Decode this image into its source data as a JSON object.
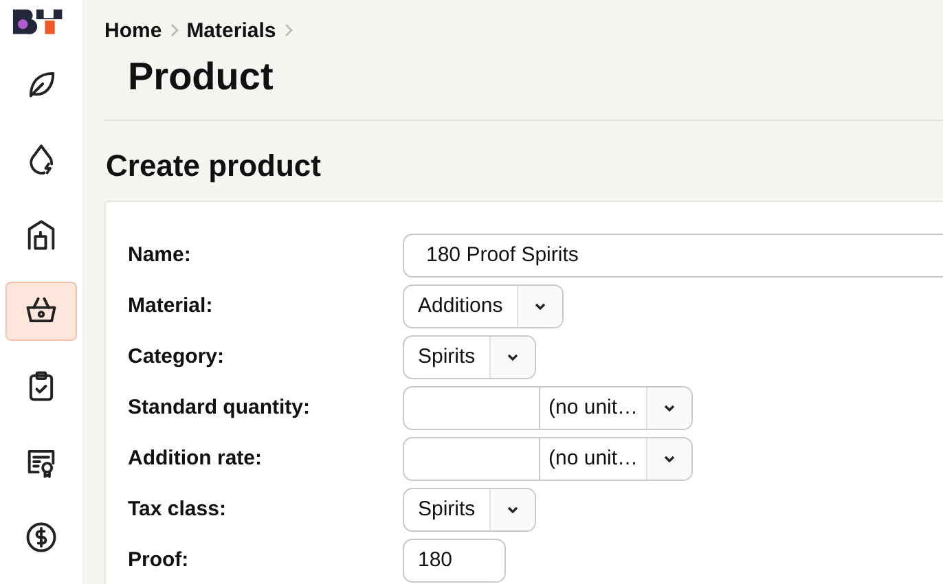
{
  "sidebar": {
    "items": [
      {
        "kind": "leaf",
        "selected": false
      },
      {
        "kind": "drop",
        "selected": false
      },
      {
        "kind": "building",
        "selected": false
      },
      {
        "kind": "basket",
        "selected": true
      },
      {
        "kind": "clipboard",
        "selected": false
      },
      {
        "kind": "certificate",
        "selected": false
      },
      {
        "kind": "coin",
        "selected": false
      }
    ]
  },
  "breadcrumb": [
    "Home",
    "Materials"
  ],
  "page_title": "Product",
  "section_title": "Create product",
  "form": {
    "fields": [
      {
        "label": "Name:",
        "kind": "text",
        "value": "180 Proof Spirits"
      },
      {
        "label": "Material:",
        "kind": "select",
        "value": "Additions"
      },
      {
        "label": "Category:",
        "kind": "select",
        "value": "Spirits"
      },
      {
        "label": "Standard quantity:",
        "kind": "quantity",
        "unit": "(no unit…"
      },
      {
        "label": "Addition rate:",
        "kind": "quantity",
        "unit": "(no unit…"
      },
      {
        "label": "Tax class:",
        "kind": "select",
        "value": "Spirits"
      },
      {
        "label": "Proof:",
        "kind": "short",
        "value": "180"
      }
    ]
  }
}
